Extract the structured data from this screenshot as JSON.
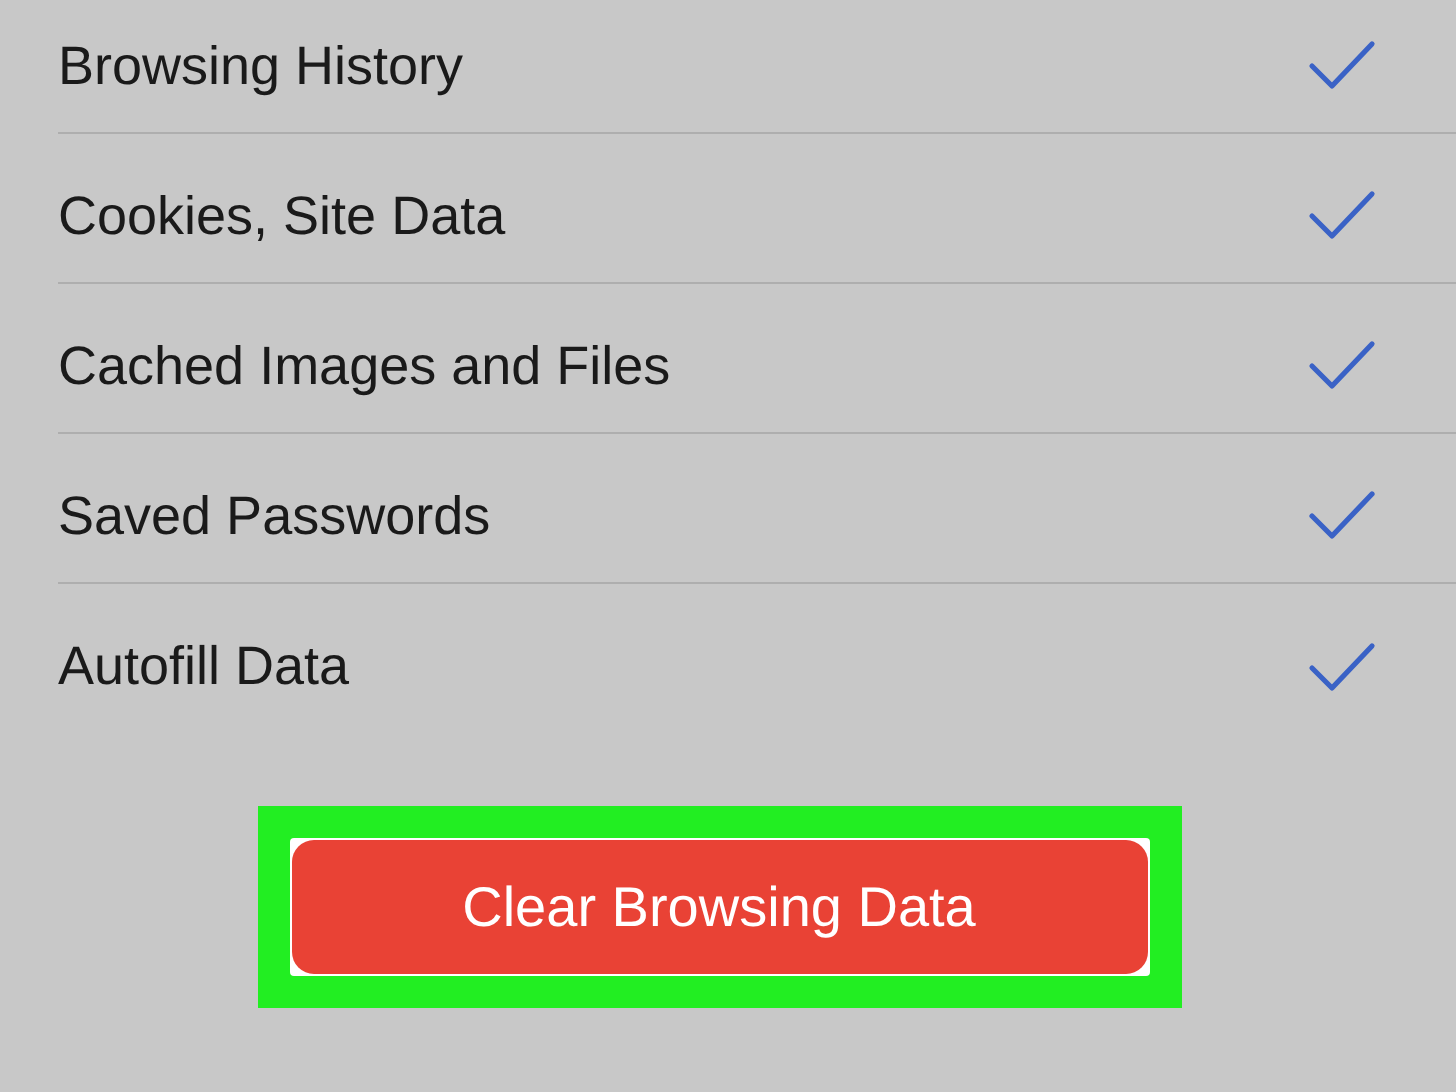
{
  "options": [
    {
      "label": "Browsing History",
      "checked": true
    },
    {
      "label": "Cookies, Site Data",
      "checked": true
    },
    {
      "label": "Cached Images and Files",
      "checked": true
    },
    {
      "label": "Saved Passwords",
      "checked": true
    },
    {
      "label": "Autofill Data",
      "checked": true
    }
  ],
  "clear_button": {
    "label": "Clear Browsing Data",
    "highlighted": true
  }
}
